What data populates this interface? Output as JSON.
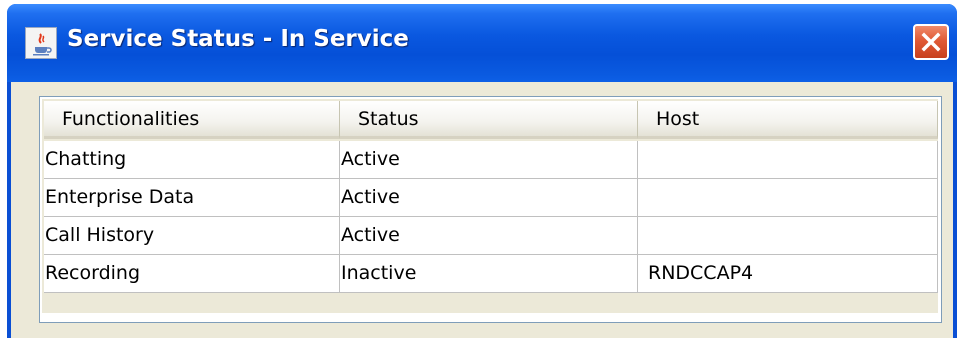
{
  "window": {
    "title": "Service Status - In Service",
    "icon": "java-cup-icon",
    "close_icon": "close-x-icon"
  },
  "table": {
    "columns": [
      "Functionalities",
      "Status",
      "Host"
    ],
    "rows": [
      {
        "functionality": "Chatting",
        "status": "Active",
        "host": ""
      },
      {
        "functionality": "Enterprise Data",
        "status": "Active",
        "host": ""
      },
      {
        "functionality": "Call History",
        "status": "Active",
        "host": ""
      },
      {
        "functionality": "Recording",
        "status": "Inactive",
        "host": "RNDCCAP4"
      }
    ]
  },
  "colors": {
    "titlebar": "#0a58e0",
    "close_button": "#e05a36",
    "client_background": "#ece9d8"
  }
}
